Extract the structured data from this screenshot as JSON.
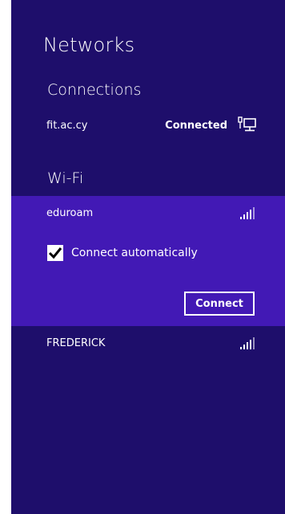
{
  "panel": {
    "title": "Networks"
  },
  "connections": {
    "heading": "Connections",
    "items": [
      {
        "name": "fit.ac.cy",
        "status": "Connected",
        "icon": "wired-network-icon"
      }
    ]
  },
  "wifi": {
    "heading": "Wi-Fi",
    "networks": [
      {
        "name": "eduroam",
        "signal_bars": 4,
        "icon": "wifi-signal-icon",
        "expanded": true,
        "connect_automatically_label": "Connect automatically",
        "connect_automatically_checked": true,
        "connect_button_label": "Connect"
      },
      {
        "name": "FREDERICK",
        "signal_bars": 4,
        "icon": "wifi-signal-icon",
        "expanded": false
      }
    ]
  },
  "colors": {
    "panel_background": "#1e0e6b",
    "selected_background": "#4219b5",
    "text": "#ffffff"
  }
}
